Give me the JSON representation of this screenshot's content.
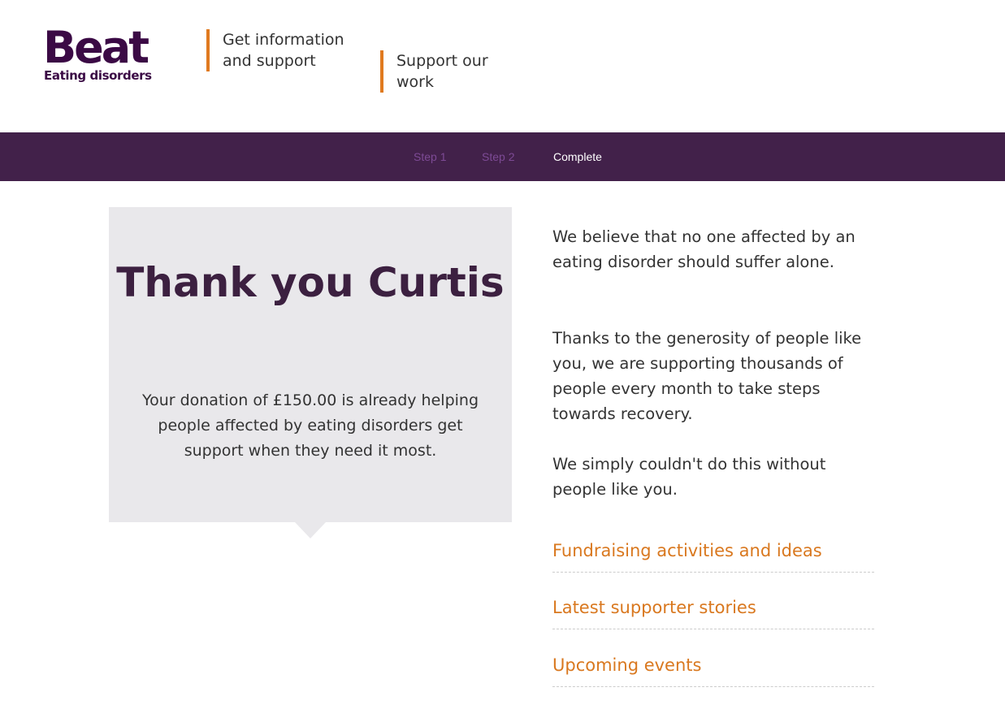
{
  "header": {
    "logo": {
      "word": "Beat",
      "subtitle": "Eating disorders"
    },
    "nav": [
      {
        "label": "Get information and support"
      },
      {
        "label": "Support our work"
      }
    ]
  },
  "steps": [
    {
      "label": "Step 1",
      "state": "done"
    },
    {
      "label": "Step 2",
      "state": "done"
    },
    {
      "label": "Complete",
      "state": "current"
    }
  ],
  "thanks": {
    "title": "Thank you Curtis",
    "message": "Your donation of £150.00 is already helping people affected by eating disorders get support when they need it most."
  },
  "side": {
    "paragraphs": [
      "We believe that no one affected by an eating disorder should suffer alone.",
      "Thanks to the generosity of people like you, we are supporting thousands of people every month to take steps towards recovery.",
      "We simply couldn't do this without people like you."
    ],
    "links": [
      {
        "label": "Fundraising activities and ideas"
      },
      {
        "label": "Latest supporter stories"
      },
      {
        "label": "Upcoming events"
      }
    ]
  },
  "colors": {
    "brand_purple": "#3b0a45",
    "steps_bar": "#42214a",
    "accent_orange": "#e07a1f",
    "link_orange": "#d9781f",
    "box_grey": "#e9e8eb"
  }
}
